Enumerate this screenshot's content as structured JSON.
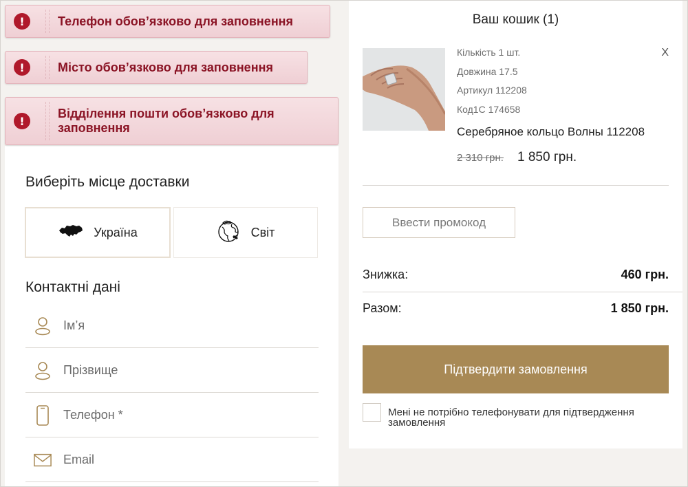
{
  "errors": [
    {
      "text": "Телефон обов’язково для заповнення"
    },
    {
      "text": "Місто обов’язково для заповнення"
    },
    {
      "text": "Відділення пошти обов’язково для заповнення"
    }
  ],
  "delivery": {
    "title": "Виберіть місце доставки",
    "options": [
      {
        "label": "Україна",
        "icon": "ukraine-map-icon",
        "selected": true
      },
      {
        "label": "Світ",
        "icon": "globe-icon",
        "selected": false
      }
    ]
  },
  "contacts": {
    "title": "Контактні дані",
    "fields": [
      {
        "placeholder": "Ім’я",
        "icon": "user-icon"
      },
      {
        "placeholder": "Прізвище",
        "icon": "user-icon"
      },
      {
        "placeholder": "Телефон *",
        "icon": "phone-icon"
      },
      {
        "placeholder": "Email",
        "icon": "mail-icon"
      }
    ]
  },
  "cart": {
    "title": "Ваш кошик (1)",
    "item": {
      "quantity": "Кількість 1 шт.",
      "length": "Довжина 17.5",
      "article": "Артикул 112208",
      "code": "Код1С 174658",
      "name": "Серебряное кольцо Волны 112208",
      "old_price": "2 310 грн.",
      "new_price": "1 850 грн.",
      "remove": "X"
    },
    "promo_label": "Ввести промокод",
    "discount_label": "Знижка:",
    "discount_value": "460 грн.",
    "total_label": "Разом:",
    "total_value": "1 850 грн.",
    "confirm_label": "Підтвердити замовлення",
    "no_call_label": "Мені не потрібно телефонувати для підтвердження замовлення"
  },
  "colors": {
    "accent": "#a88955",
    "error_text": "#8b1425",
    "error_bg": "#f2d6da"
  }
}
